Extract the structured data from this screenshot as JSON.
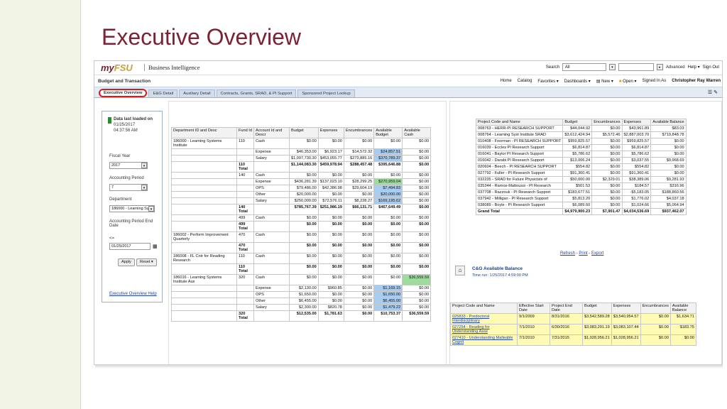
{
  "slide": {
    "title": "Executive Overview"
  },
  "top": {
    "logo_my": "my",
    "logo_fsu": "FSU",
    "bi": "Business Intelligence",
    "search_label": "Search",
    "search_value": "All",
    "advanced": "Advanced",
    "help": "Help ▾",
    "signout": "Sign Out"
  },
  "nav": {
    "dashboard_title": "Budget and Transaction",
    "home": "Home",
    "catalog": "Catalog",
    "favorites": "Favorites ▾",
    "dashboards": "Dashboards ▾",
    "new": "New ▾",
    "open": "Open ▾",
    "signed_in": "Signed In As",
    "user": "Christopher Ray Warren"
  },
  "tabs": [
    "Executive Overview",
    "E&G Detail",
    "Auxiliary Detail",
    "Contracts, Grants, SRAD, & PI Support",
    "Sponsored Project Lookup"
  ],
  "filters": {
    "data_loaded": "Data last loaded on",
    "date": "01/25/2017",
    "time": "04:37:56 AM",
    "fiscal_year_label": "Fiscal Year",
    "fiscal_year": "2017",
    "period_label": "Accounting Period",
    "period": "7",
    "dept_label": "Department",
    "dept": "186000 - Learning Sys",
    "end_label": "Accounting Period End Date",
    "le": "<=",
    "end_value": "01/25/2017",
    "apply": "Apply",
    "reset": "Reset ▾",
    "help_link": "Executive Overview Help"
  },
  "fund_table": {
    "headers": [
      "Department ID and Desc",
      "Fund Id",
      "Account Id and Descr",
      "Budget",
      "Expenses",
      "Encumbrances",
      "Available Budget",
      "Available Cash"
    ],
    "rows": [
      [
        "186000 - Learning Systems Institute",
        "110",
        "Cash",
        "$0.00",
        "$0.00",
        "$0.00",
        "$0.00",
        "$0.00"
      ],
      [
        "",
        "",
        "Expense",
        "$46,353.00",
        "$6,923.17",
        "$14,572.32",
        "$24,857.51",
        "$0.00"
      ],
      [
        "",
        "",
        "Salary",
        "$1,097,730.30",
        "$453,055.77",
        "$273,885.16",
        "$370,789.37",
        "$0.00"
      ],
      [
        "",
        "110 Total",
        "",
        "$1,144,083.30",
        "$459,978.94",
        "$288,457.48",
        "$395,646.88",
        "$0.00"
      ],
      [
        "",
        "140",
        "Cash",
        "$0.00",
        "$0.00",
        "$0.00",
        "$0.00",
        "$0.00"
      ],
      [
        "",
        "",
        "Expense",
        "$436,281.39",
        "$137,023.10",
        "$28,299.25",
        "$270,959.04",
        "$0.00"
      ],
      [
        "",
        "",
        "OPS",
        "$79,486.00",
        "$42,386.98",
        "$29,604.19",
        "$7,494.83",
        "$0.00"
      ],
      [
        "",
        "",
        "Other",
        "$20,000.00",
        "$0.00",
        "$0.00",
        "$20,000.00",
        "$0.00"
      ],
      [
        "",
        "",
        "Salary",
        "$250,000.00",
        "$72,576.11",
        "$8,228.27",
        "$169,195.62",
        "$0.00"
      ],
      [
        "",
        "140 Total",
        "",
        "$785,767.39",
        "$251,986.19",
        "$66,131.71",
        "$467,649.49",
        "$0.00"
      ],
      [
        "",
        "499",
        "Cash",
        "$0.00",
        "$0.00",
        "$0.00",
        "$0.00",
        "$0.00"
      ],
      [
        "",
        "499 Total",
        "",
        "$0.00",
        "$0.00",
        "$0.00",
        "$0.00",
        "$0.00"
      ],
      [
        "186002 - Perform Improvement Quarterly",
        "470",
        "Cash",
        "$0.00",
        "$0.00",
        "$0.00",
        "$0.00",
        "$0.00"
      ],
      [
        "",
        "470 Total",
        "",
        "$0.00",
        "$0.00",
        "$0.00",
        "$0.00",
        "$0.00"
      ],
      [
        "186008 - FL Cntr for Reading Research",
        "110",
        "Cash",
        "$0.00",
        "$0.00",
        "$0.00",
        "$0.00",
        "$0.00"
      ],
      [
        "",
        "110 Total",
        "",
        "$0.00",
        "$0.00",
        "$0.00",
        "$0.00",
        "$0.00"
      ],
      [
        "186016 - Learning Systems Institute Aux",
        "320",
        "Cash",
        "$0.00",
        "$0.00",
        "$0.00",
        "$0.00",
        "$36,559.59"
      ],
      [
        "",
        "",
        "Expense",
        "$2,130.00",
        "$960.85",
        "$0.00",
        "$1,169.15",
        "$0.00"
      ],
      [
        "",
        "",
        "OPS",
        "$1,650.00",
        "$0.00",
        "$0.00",
        "$1,650.00",
        "$0.00"
      ],
      [
        "",
        "",
        "Other",
        "$6,455.00",
        "$0.00",
        "$0.00",
        "$6,455.00",
        "$0.00"
      ],
      [
        "",
        "",
        "Salary",
        "$2,300.00",
        "$820.78",
        "$0.00",
        "$1,479.22",
        "$0.00"
      ],
      [
        "",
        "320 Total",
        "",
        "$12,535.00",
        "$1,781.63",
        "$0.00",
        "$10,753.37",
        "$36,559.59"
      ]
    ]
  },
  "project_table": {
    "headers": [
      "Project Code and Name",
      "Budget",
      "Encumbrances",
      "Expenses",
      "Available Balance"
    ],
    "rows": [
      [
        "008763 - HERR-PI RESEARCH SUPPORT",
        "$44,044.92",
        "$0.00",
        "$43,961.89",
        "$83.03"
      ],
      [
        "008764 - Learning Syst Institute SRAD",
        "$3,612,424.94",
        "$5,572.46",
        "$2,887,003.70",
        "$719,848.78"
      ],
      [
        "010408 - Foorman - PI RESEARCH SUPPORT",
        "$959,825.57",
        "$0.00",
        "$959,825.57",
        "$0.00"
      ],
      [
        "016039 - Eccles PI Research Support",
        "$6,814.87",
        "$0.00",
        "$6,814.87",
        "$0.00"
      ],
      [
        "016041 - Baylor PI Research Support",
        "$5,786.62",
        "$0.00",
        "$5,786.62",
        "$0.00"
      ],
      [
        "016042 - Darabi PI Research Support",
        "$13,006.24",
        "$0.00",
        "$3,037.55",
        "$9,968.69"
      ],
      [
        "020604 - Beech - PI RESEARCH SUPPORT",
        "$554.82",
        "$0.00",
        "$554.82",
        "$0.00"
      ],
      [
        "027792 - Fuller - PI Research Support",
        "$91,360.41",
        "$0.00",
        "$91,360.41",
        "$0.00"
      ],
      [
        "032235 - SRAD for Future Physicists of",
        "$50,000.00",
        "$2,329.01",
        "$38,389.06",
        "$9,281.93"
      ],
      [
        "035344 - Ramos-Mattoussi - PI Research",
        "$501.53",
        "$0.00",
        "$184.57",
        "$316.96"
      ],
      [
        "037708 - Razzouk - PI Research Support",
        "$183,677.51",
        "$0.00",
        "-$5,183.05",
        "$188,860.56"
      ],
      [
        "037942 - Milligan - PI Research Support",
        "$5,813.20",
        "$0.00",
        "$1,776.02",
        "$4,037.18"
      ],
      [
        "038089 - Boyle - PI Research Support",
        "$6,089.60",
        "$0.00",
        "$1,024.66",
        "$5,064.94"
      ],
      [
        "Grand Total",
        "$4,979,900.23",
        "$7,901.47",
        "$4,034,536.69",
        "$937,462.07"
      ]
    ]
  },
  "links": {
    "refresh": "Refresh",
    "print": "Print",
    "export": "Export"
  },
  "cg": {
    "title": "C&G Available Balance",
    "time": "Time run: 1/25/2017 4:59:00 PM",
    "headers": [
      "Project Code and Name",
      "Effective Start Date",
      "Project End Date",
      "Budget",
      "Expenses",
      "Encumbrances",
      "Available Balance"
    ],
    "rows": [
      [
        "025833 - Predoctoral Interdisciplinary",
        "9/1/2009",
        "8/31/2016",
        "$3,542,589.28",
        "$3,540,954.57",
        "$0.00",
        "$1,634.71"
      ],
      [
        "027254 - Reading for Understanding Asse",
        "7/1/2010",
        "6/30/2016",
        "$3,083,291.19",
        "$3,083,107.44",
        "$0.00",
        "$183.75"
      ],
      [
        "027410 - Understanding Malleable Cognit",
        "7/1/2010",
        "7/31/2015",
        "$1,028,956.21",
        "$1,028,956.21",
        "$0.00",
        "$0.00"
      ]
    ]
  }
}
